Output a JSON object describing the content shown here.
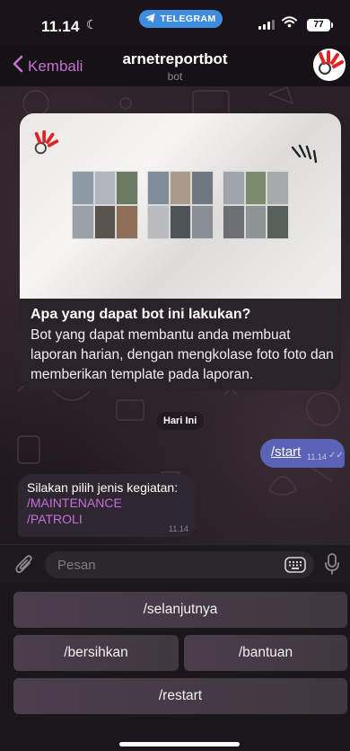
{
  "status_bar": {
    "time": "11.14",
    "app_pill": "TELEGRAM",
    "battery": "77"
  },
  "header": {
    "back_label": "Kembali",
    "title": "arnetreportbot",
    "subtitle": "bot"
  },
  "intro_card": {
    "heading": "Apa yang dapat bot ini lakukan?",
    "body": "Bot yang dapat membantu anda membuat laporan harian, dengan mengkolase foto foto dan memberikan template pada laporan."
  },
  "date_divider": "Hari Ini",
  "messages": {
    "outgoing": {
      "text": "/start",
      "time": "11.14"
    },
    "incoming": {
      "text": "Silakan pilih jenis kegiatan:",
      "commands": [
        "/MAINTENANCE",
        "/PATROLI"
      ],
      "time": "11.14"
    }
  },
  "input": {
    "placeholder": "Pesan"
  },
  "keyboard": {
    "buttons": [
      "/selanjutnya",
      "/bersihkan",
      "/bantuan",
      "/restart"
    ]
  },
  "colors": {
    "accent": "#c770d6",
    "outgoing_bubble": "#5a63b5",
    "telegram_pill": "#3d8ce0"
  },
  "icons": [
    "moon-icon",
    "telegram-icon",
    "signal-icon",
    "wifi-icon",
    "battery-icon",
    "chevron-left-icon",
    "bot-avatar-icon",
    "paperclip-icon",
    "keyboard-icon",
    "microphone-icon",
    "double-check-icon"
  ]
}
